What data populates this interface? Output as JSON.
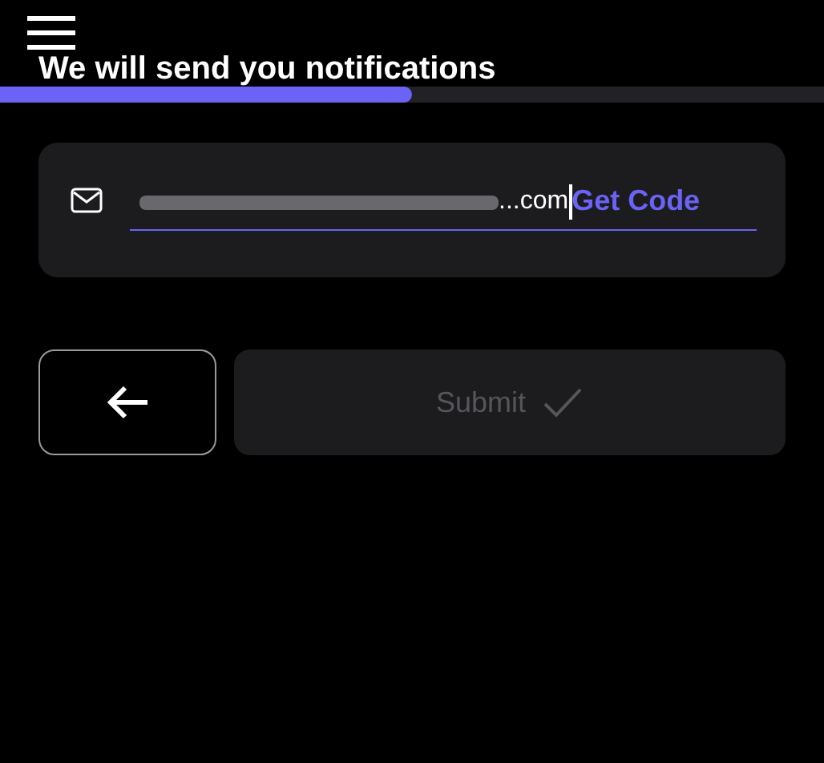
{
  "heading": "We will send you notifications",
  "progress": {
    "level": 0.5
  },
  "email_field": {
    "value": "...com",
    "redacted": true,
    "focused": true
  },
  "get_code_button": "Get Code",
  "submit_button": {
    "label": "Submit",
    "disabled": true
  }
}
